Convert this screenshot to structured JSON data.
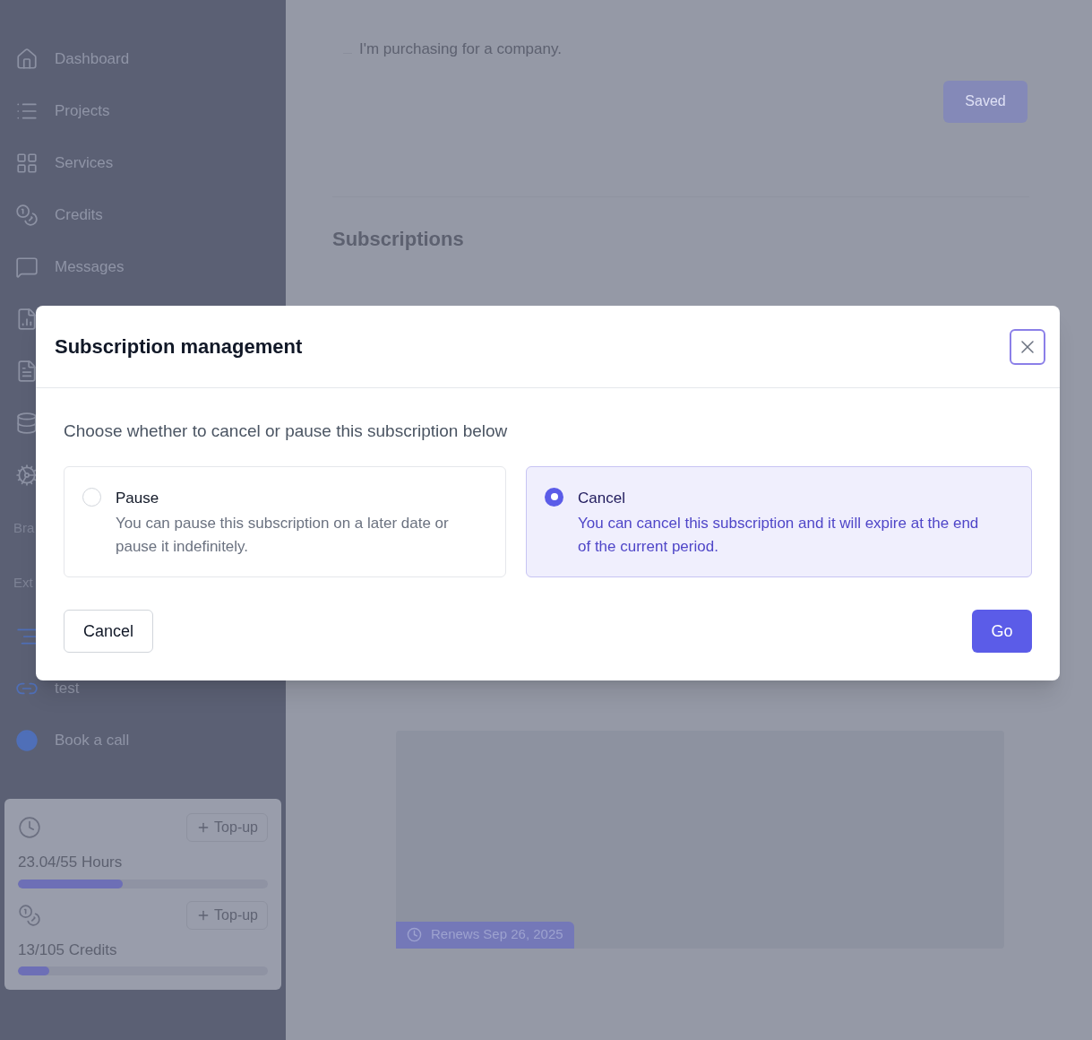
{
  "sidebar": {
    "items": [
      {
        "kind": "link",
        "label": "Dashboard"
      },
      {
        "kind": "link",
        "label": "Projects"
      },
      {
        "kind": "link",
        "label": "Services"
      },
      {
        "kind": "link",
        "label": "Credits"
      },
      {
        "kind": "link",
        "label": "Messages"
      },
      {
        "kind": "covered"
      },
      {
        "kind": "covered"
      },
      {
        "kind": "covered"
      },
      {
        "kind": "covered"
      },
      {
        "kind": "heading",
        "label": "Bra"
      },
      {
        "kind": "heading",
        "label": "Ext"
      },
      {
        "kind": "covered"
      },
      {
        "kind": "link",
        "label": "test"
      },
      {
        "kind": "link",
        "label": "Book a call"
      }
    ],
    "usage": [
      {
        "button": "Top-up",
        "reading": "23.04/55 Hours",
        "level": 0.42
      },
      {
        "button": "Top-up",
        "reading": "13/105 Credits",
        "level": 0.124
      }
    ]
  },
  "main": {
    "company_checkbox": {
      "label": "I'm purchasing for a company.",
      "checked": false
    },
    "save_button": {
      "label": "Saved",
      "disabled": true
    },
    "heading": "Subscriptions",
    "renewal_badge": "Renews Sep 26, 2025"
  },
  "modal": {
    "title": "Subscription management",
    "intro": "Choose whether to cancel or pause this subscription below",
    "options": [
      {
        "title": "Pause",
        "description": "You can pause this subscription on a later date or pause it indefinitely.",
        "selected": false
      },
      {
        "title": "Cancel",
        "description": "You can cancel this subscription and it will expire at the end of the current period.",
        "selected": true
      }
    ],
    "buttons": [
      {
        "label": "Cancel",
        "kind": "secondary"
      },
      {
        "label": "Go",
        "kind": "primary"
      }
    ]
  }
}
